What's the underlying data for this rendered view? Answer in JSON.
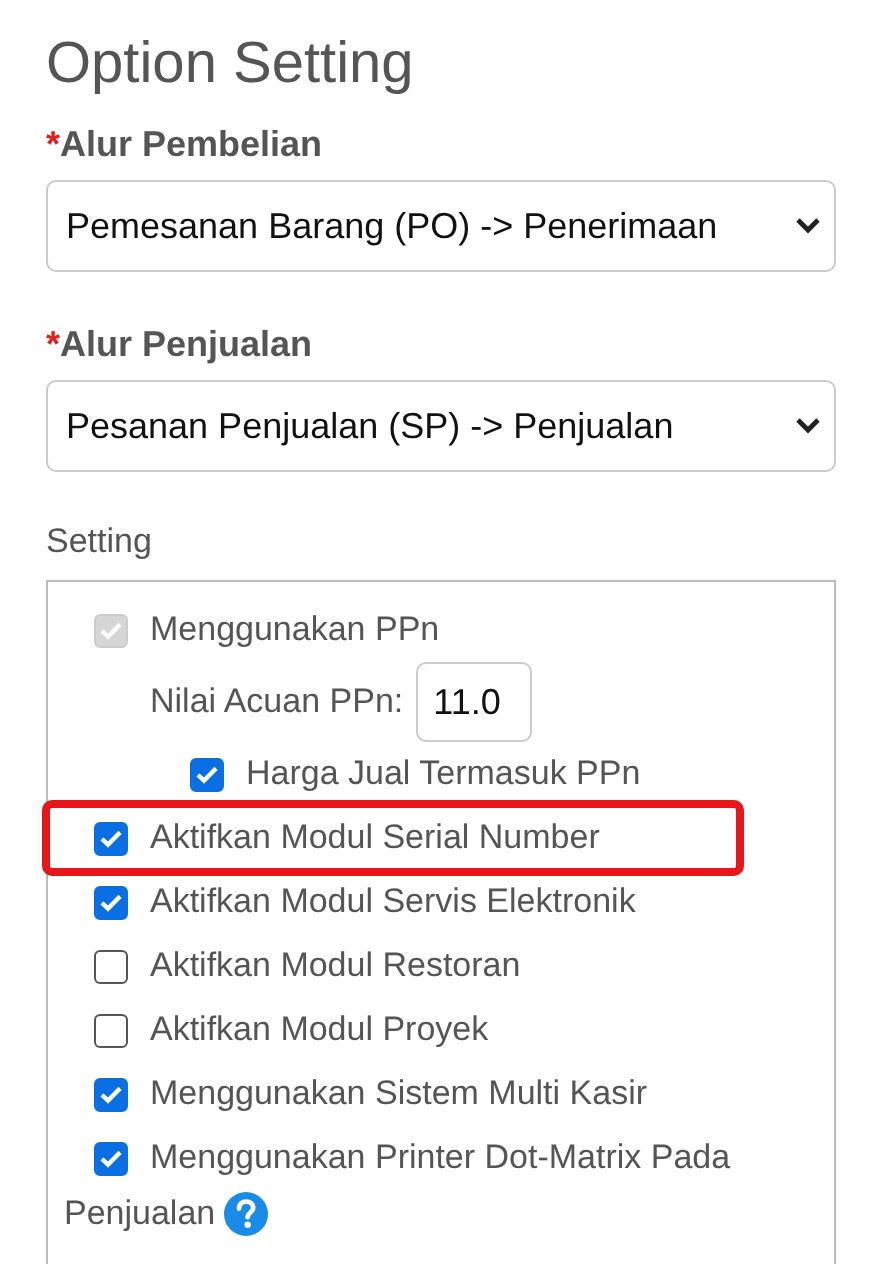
{
  "title": "Option Setting",
  "selects": [
    {
      "mark": "*",
      "label": "Alur Pembelian",
      "value": "Pemesanan Barang (PO) -> Penerimaan"
    },
    {
      "mark": "*",
      "label": "Alur Penjualan",
      "value": "Pesanan Penjualan (SP) -> Penjualan"
    }
  ],
  "settings": {
    "label": "Setting",
    "items": [
      {
        "kind": "checkbox",
        "label": "Menggunakan PPn",
        "checked": true,
        "disabled": true,
        "highlighted": false,
        "children": [
          {
            "kind": "number",
            "label": "Nilai Acuan PPn:",
            "value": "11.0",
            "children": [
              {
                "kind": "checkbox",
                "label": "Harga Jual Termasuk PPn",
                "checked": true,
                "disabled": false,
                "highlighted": false
              }
            ]
          }
        ]
      },
      {
        "kind": "checkbox",
        "label": "Aktifkan Modul Serial Number",
        "checked": true,
        "disabled": false,
        "highlighted": true
      },
      {
        "kind": "checkbox",
        "label": "Aktifkan Modul Servis Elektronik",
        "checked": true,
        "disabled": false,
        "highlighted": false
      },
      {
        "kind": "checkbox",
        "label": "Aktifkan Modul Restoran",
        "checked": false,
        "disabled": false,
        "highlighted": false
      },
      {
        "kind": "checkbox",
        "label": "Aktifkan Modul Proyek",
        "checked": false,
        "disabled": false,
        "highlighted": false
      },
      {
        "kind": "checkbox",
        "label": "Menggunakan Sistem Multi Kasir",
        "checked": true,
        "disabled": false,
        "highlighted": false
      },
      {
        "kind": "checkbox",
        "label": "Menggunakan Printer Dot-Matrix Pada",
        "label_continued": "Penjualan",
        "checked": true,
        "disabled": false,
        "highlighted": false,
        "help": true
      }
    ]
  }
}
